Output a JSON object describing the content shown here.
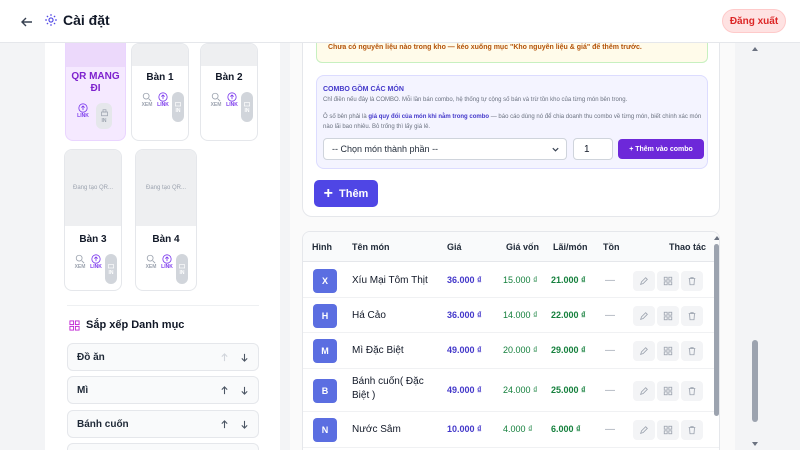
{
  "header": {
    "title": "Cài đặt",
    "logout_label": "Đăng xuất"
  },
  "tables_grid": {
    "takeaway": {
      "name": "QR MANG ĐI",
      "link_label": "LINK",
      "print_label": "IN"
    },
    "tiles": [
      {
        "name": "Bàn 1",
        "view_label": "XEM",
        "link_label": "LINK",
        "print_label": "IN",
        "generating": ""
      },
      {
        "name": "Bàn 2",
        "view_label": "XEM",
        "link_label": "LINK",
        "print_label": "IN",
        "generating": ""
      },
      {
        "name": "Bàn 3",
        "view_label": "XEM",
        "link_label": "LINK",
        "print_label": "IN",
        "generating": "Đang tạo QR..."
      },
      {
        "name": "Bàn 4",
        "view_label": "XEM",
        "link_label": "LINK",
        "print_label": "IN",
        "generating": "Đang tạo QR..."
      }
    ]
  },
  "sort_categories": {
    "title": "Sắp xếp Danh mục",
    "items": [
      "Đồ ăn",
      "Mì",
      "Bánh cuốn"
    ]
  },
  "form": {
    "warning": "Chưa có nguyên liệu nào trong kho — kéo xuống mục \"Kho nguyên liệu & giá\" để thêm trước.",
    "combo_title": "COMBO GỒM CÁC MÓN",
    "combo_desc": "Chỉ điền nếu đây là COMBO. Mỗi lần bán combo, hệ thống tự cộng số bán và trừ tồn kho của từng món bên trong.",
    "combo_note_prefix": "Ô số bên phải là ",
    "combo_note_bold": "giá quy đổi của món khi nằm trong combo",
    "combo_note_suffix": " — báo cáo dùng nó để chia doanh thu combo về từng món, biết chính xác món nào lãi bao nhiêu. Bỏ trống thì lấy giá lẻ.",
    "select_placeholder": "-- Chọn món thành phần --",
    "quantity": "1",
    "add_to_combo_label": "+ Thêm vào combo",
    "add_label": "Thêm"
  },
  "menu_table": {
    "headers": {
      "image": "Hình",
      "name": "Tên món",
      "price": "Giá",
      "cost": "Giá vốn",
      "profit": "Lãi/món",
      "stock": "Tồn",
      "actions": "Thao tác"
    },
    "rows": [
      {
        "initial": "X",
        "name": "Xíu Mại Tôm Thịt",
        "price": "36.000 ₫",
        "cost": "15.000 ₫",
        "profit": "21.000 ₫",
        "stock": "—"
      },
      {
        "initial": "H",
        "name": "Há Cảo",
        "price": "36.000 ₫",
        "cost": "14.000 ₫",
        "profit": "22.000 ₫",
        "stock": "—"
      },
      {
        "initial": "M",
        "name": "Mì Đặc Biệt",
        "price": "49.000 ₫",
        "cost": "20.000 ₫",
        "profit": "29.000 ₫",
        "stock": "—"
      },
      {
        "initial": "B",
        "name": "Bánh cuốn( Đặc Biệt )",
        "price": "49.000 ₫",
        "cost": "24.000 ₫",
        "profit": "25.000 ₫",
        "stock": "—"
      },
      {
        "initial": "N",
        "name": "Nước Sâm",
        "price": "10.000 ₫",
        "cost": "4.000 ₫",
        "profit": "6.000 ₫",
        "stock": "—"
      }
    ]
  },
  "colors": {
    "accent": "#4f46e5",
    "purple": "#7e22ce",
    "danger": "#dc2626",
    "money": "#15803d"
  }
}
